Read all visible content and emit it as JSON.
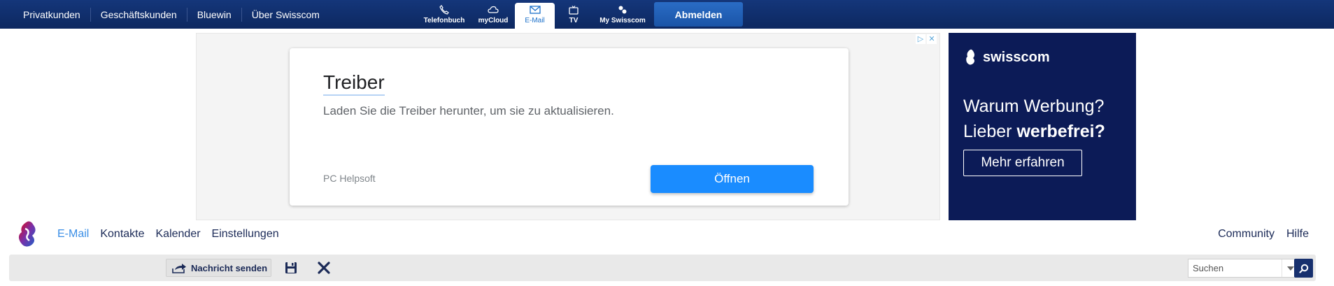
{
  "topbar": {
    "links": [
      "Privatkunden",
      "Geschäftskunden",
      "Bluewin",
      "Über Swisscom"
    ],
    "services": [
      {
        "label": "Telefonbuch",
        "icon": "phone-icon"
      },
      {
        "label": "myCloud",
        "icon": "cloud-icon"
      },
      {
        "label": "E-Mail",
        "icon": "envelope-icon",
        "active": true
      },
      {
        "label": "TV",
        "icon": "tv-icon"
      },
      {
        "label": "My Swisscom",
        "icon": "user-group-icon"
      }
    ],
    "logout_label": "Abmelden"
  },
  "ad": {
    "title": "Treiber",
    "description": "Laden Sie die Treiber herunter, um sie zu aktualisieren.",
    "source": "PC Helpsoft",
    "cta": "Öffnen"
  },
  "promo": {
    "brand": "swisscom",
    "line1": "Warum Werbung?",
    "line2_prefix": "Lieber ",
    "line2_bold": "werbefrei?",
    "cta": "Mehr erfahren"
  },
  "appnav": {
    "items": [
      "E-Mail",
      "Kontakte",
      "Kalender",
      "Einstellungen"
    ],
    "active": "E-Mail",
    "right_items": [
      "Community",
      "Hilfe"
    ]
  },
  "toolbar": {
    "send_label": "Nachricht senden",
    "search_placeholder": "Suchen"
  },
  "colors": {
    "topbar": "#0f2d6b",
    "accent": "#3a8ee6",
    "ad_button": "#1a8cff",
    "promo_bg": "#0c1b57"
  }
}
